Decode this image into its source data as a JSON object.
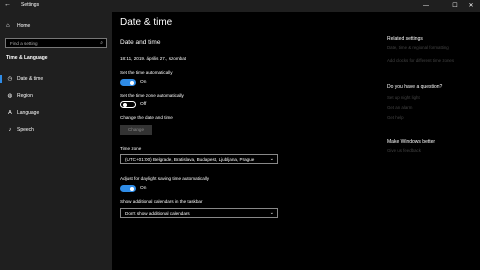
{
  "titlebar": {
    "back_icon": "←",
    "title": "Settings",
    "minimize": "—",
    "maximize": "☐",
    "close": "✕"
  },
  "sidebar": {
    "home": {
      "icon": "⌂",
      "label": "Home"
    },
    "search": {
      "placeholder": "Find a setting",
      "icon": "⌕"
    },
    "section": "Time & Language",
    "items": [
      {
        "label": "Date & time",
        "icon": "◷",
        "active": true
      },
      {
        "label": "Region",
        "icon": "◍",
        "active": false
      },
      {
        "label": "Language",
        "icon": "A",
        "active": false
      },
      {
        "label": "Speech",
        "icon": "♪",
        "active": false
      }
    ]
  },
  "main": {
    "title": "Date & time",
    "subtitle": "Date and time",
    "current": "18:11, 2019. április 27., szombat",
    "set_time_auto": {
      "label": "Set the time automatically",
      "state": "On"
    },
    "set_zone_auto": {
      "label": "Set the time zone automatically",
      "state": "Off"
    },
    "change_label": "Change the date and time",
    "change_button": "Change",
    "timezone": {
      "label": "Time zone",
      "value": "(UTC+01:00) Belgrade, Bratislava, Budapest, Ljubljana, Prague"
    },
    "dst": {
      "label": "Adjust for daylight saving time automatically",
      "state": "On"
    },
    "calendars": {
      "label": "Show additional calendars in the taskbar",
      "value": "Don't show additional calendars"
    }
  },
  "right_panel": {
    "related": {
      "header": "Related settings",
      "links": [
        "Date, time & regional formatting",
        "Add clocks for different time zones"
      ]
    },
    "question": {
      "header": "Do you have a question?",
      "links": [
        "Set up night light",
        "Get an alarm",
        "Get help"
      ]
    },
    "better": {
      "header": "Make Windows better",
      "links": [
        "Give us feedback"
      ]
    }
  },
  "colors": {
    "accent": "#2e8be6",
    "background": "#000000",
    "sidebar": "#1f1f1f"
  }
}
